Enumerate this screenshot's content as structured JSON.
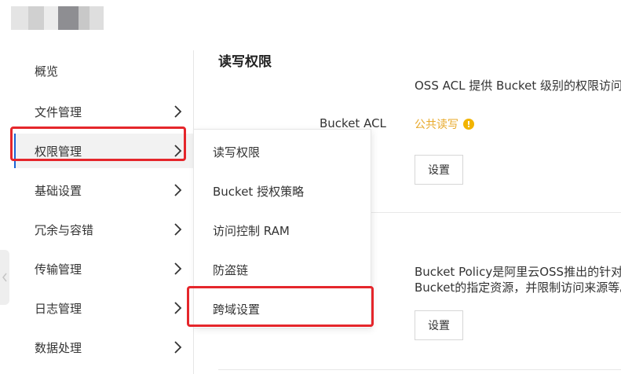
{
  "sidebar": {
    "items": [
      {
        "label": "概览",
        "chevron": false,
        "active": false
      },
      {
        "label": "文件管理",
        "chevron": true,
        "active": false
      },
      {
        "label": "权限管理",
        "chevron": true,
        "active": true
      },
      {
        "label": "基础设置",
        "chevron": true,
        "active": false
      },
      {
        "label": "冗余与容错",
        "chevron": true,
        "active": false
      },
      {
        "label": "传输管理",
        "chevron": true,
        "active": false
      },
      {
        "label": "日志管理",
        "chevron": true,
        "active": false
      },
      {
        "label": "数据处理",
        "chevron": true,
        "active": false
      }
    ]
  },
  "flyout": {
    "items": [
      {
        "label": "读写权限"
      },
      {
        "label": "Bucket 授权策略"
      },
      {
        "label": "访问控制 RAM"
      },
      {
        "label": "防盗链"
      },
      {
        "label": "跨域设置"
      }
    ]
  },
  "main": {
    "section_title": "读写权限",
    "acl_description": "OSS ACL 提供 Bucket 级别的权限访问控",
    "bucket_acl_label": "Bucket ACL",
    "bucket_acl_value": "公共读写",
    "warning_symbol": "!",
    "settings_button": "设置",
    "policy_description_line1": "Bucket Policy是阿里云OSS推出的针对B",
    "policy_description_line2": "Bucket的指定资源，并限制访问来源等。",
    "policy_settings_button": "设置"
  },
  "colors": {
    "highlight": "#e5262b",
    "active_bar": "#1a64d6",
    "acl_value": "#e8a92a",
    "warning": "#f2b400"
  }
}
